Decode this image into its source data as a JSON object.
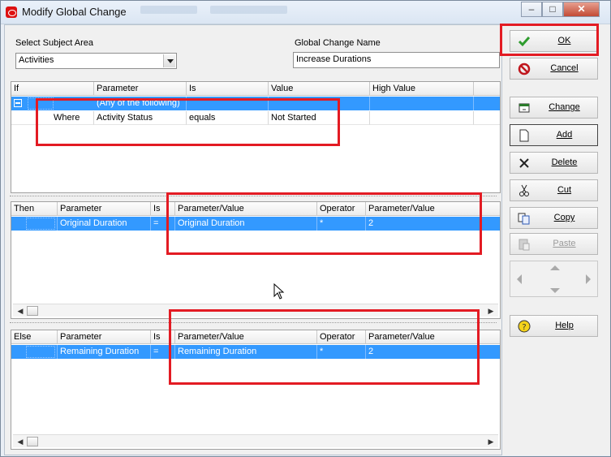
{
  "window": {
    "title": "Modify Global Change",
    "min_label": "‒",
    "max_label": "□",
    "close_label": "✕"
  },
  "header": {
    "subject_label": "Select Subject Area",
    "subject_value": "Activities",
    "name_label": "Global Change Name",
    "name_value": "Increase Durations"
  },
  "if_grid": {
    "columns": [
      "If",
      "Parameter",
      "Is",
      "Value",
      "High Value"
    ],
    "rows": [
      {
        "c0": "",
        "c1": "(Any of the following)",
        "c2": "",
        "c3": "",
        "c4": ""
      },
      {
        "c0": "Where",
        "c1": "Activity Status",
        "c2": "equals",
        "c3": "Not Started",
        "c4": ""
      }
    ]
  },
  "then_grid": {
    "columns": [
      "Then",
      "Parameter",
      "Is",
      "Parameter/Value",
      "Operator",
      "Parameter/Value"
    ],
    "rows": [
      {
        "c0": "",
        "c1": "Original Duration",
        "c2": "=",
        "c3": "Original Duration",
        "c4": "*",
        "c5": "2"
      }
    ]
  },
  "else_grid": {
    "columns": [
      "Else",
      "Parameter",
      "Is",
      "Parameter/Value",
      "Operator",
      "Parameter/Value"
    ],
    "rows": [
      {
        "c0": "",
        "c1": "Remaining Duration",
        "c2": "=",
        "c3": "Remaining Duration",
        "c4": "*",
        "c5": "2"
      }
    ]
  },
  "scroll": {
    "left": "◀",
    "right": "▶"
  },
  "buttons": {
    "ok": "OK",
    "cancel": "Cancel",
    "change": "Change",
    "add": "Add",
    "delete": "Delete",
    "cut": "Cut",
    "copy": "Copy",
    "paste": "Paste",
    "help": "Help"
  },
  "colors": {
    "selection": "#3399ff",
    "highlight_box": "#e31b23",
    "ok_check": "#2e9c2e",
    "cancel_icon": "#c0161d"
  }
}
